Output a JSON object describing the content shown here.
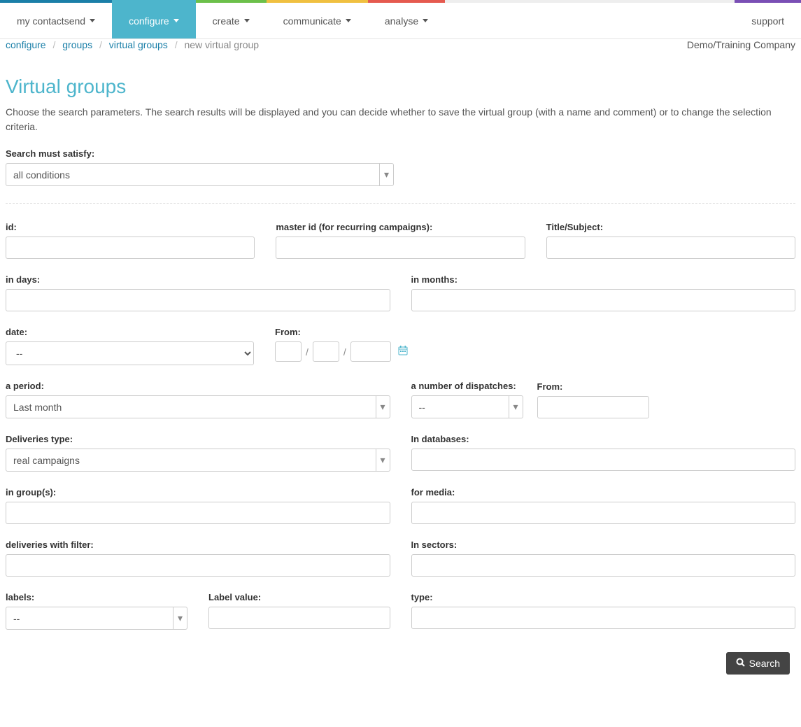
{
  "nav": {
    "items": [
      {
        "label": "my contactsend",
        "color": "#1a7fa8"
      },
      {
        "label": "configure",
        "color": "#4db5cc",
        "active": true
      },
      {
        "label": "create",
        "color": "#6cc04a"
      },
      {
        "label": "communicate",
        "color": "#f0c040"
      },
      {
        "label": "analyse",
        "color": "#e55a4f"
      }
    ],
    "support": {
      "label": "support",
      "color": "#7a4fb5"
    }
  },
  "breadcrumb": {
    "items": [
      "configure",
      "groups",
      "virtual groups"
    ],
    "current": "new virtual group"
  },
  "company": "Demo/Training Company",
  "page_title": "Virtual groups",
  "description": "Choose the search parameters. The search results will be displayed and you can decide whether to save the virtual group (with a name and comment) or to change the selection criteria.",
  "satisfy": {
    "label": "Search must satisfy:",
    "value": "all conditions"
  },
  "fields": {
    "id": "id:",
    "master_id": "master id (for recurring campaigns):",
    "title_subject": "Title/Subject:",
    "in_days": "in days:",
    "in_months": "in months:",
    "date": "date:",
    "date_value": "--",
    "from_date": "From:",
    "a_period": "a period:",
    "a_period_value": "Last month",
    "num_dispatches": "a number of dispatches:",
    "num_dispatches_value": "--",
    "from_dispatch": "From:",
    "deliveries_type": "Deliveries type:",
    "deliveries_type_value": "real campaigns",
    "in_databases": "In databases:",
    "in_groups": "in group(s):",
    "for_media": "for media:",
    "deliveries_filter": "deliveries with filter:",
    "in_sectors": "In sectors:",
    "labels": "labels:",
    "labels_value": "--",
    "label_value": "Label value:",
    "type": "type:"
  },
  "search_button": "Search"
}
